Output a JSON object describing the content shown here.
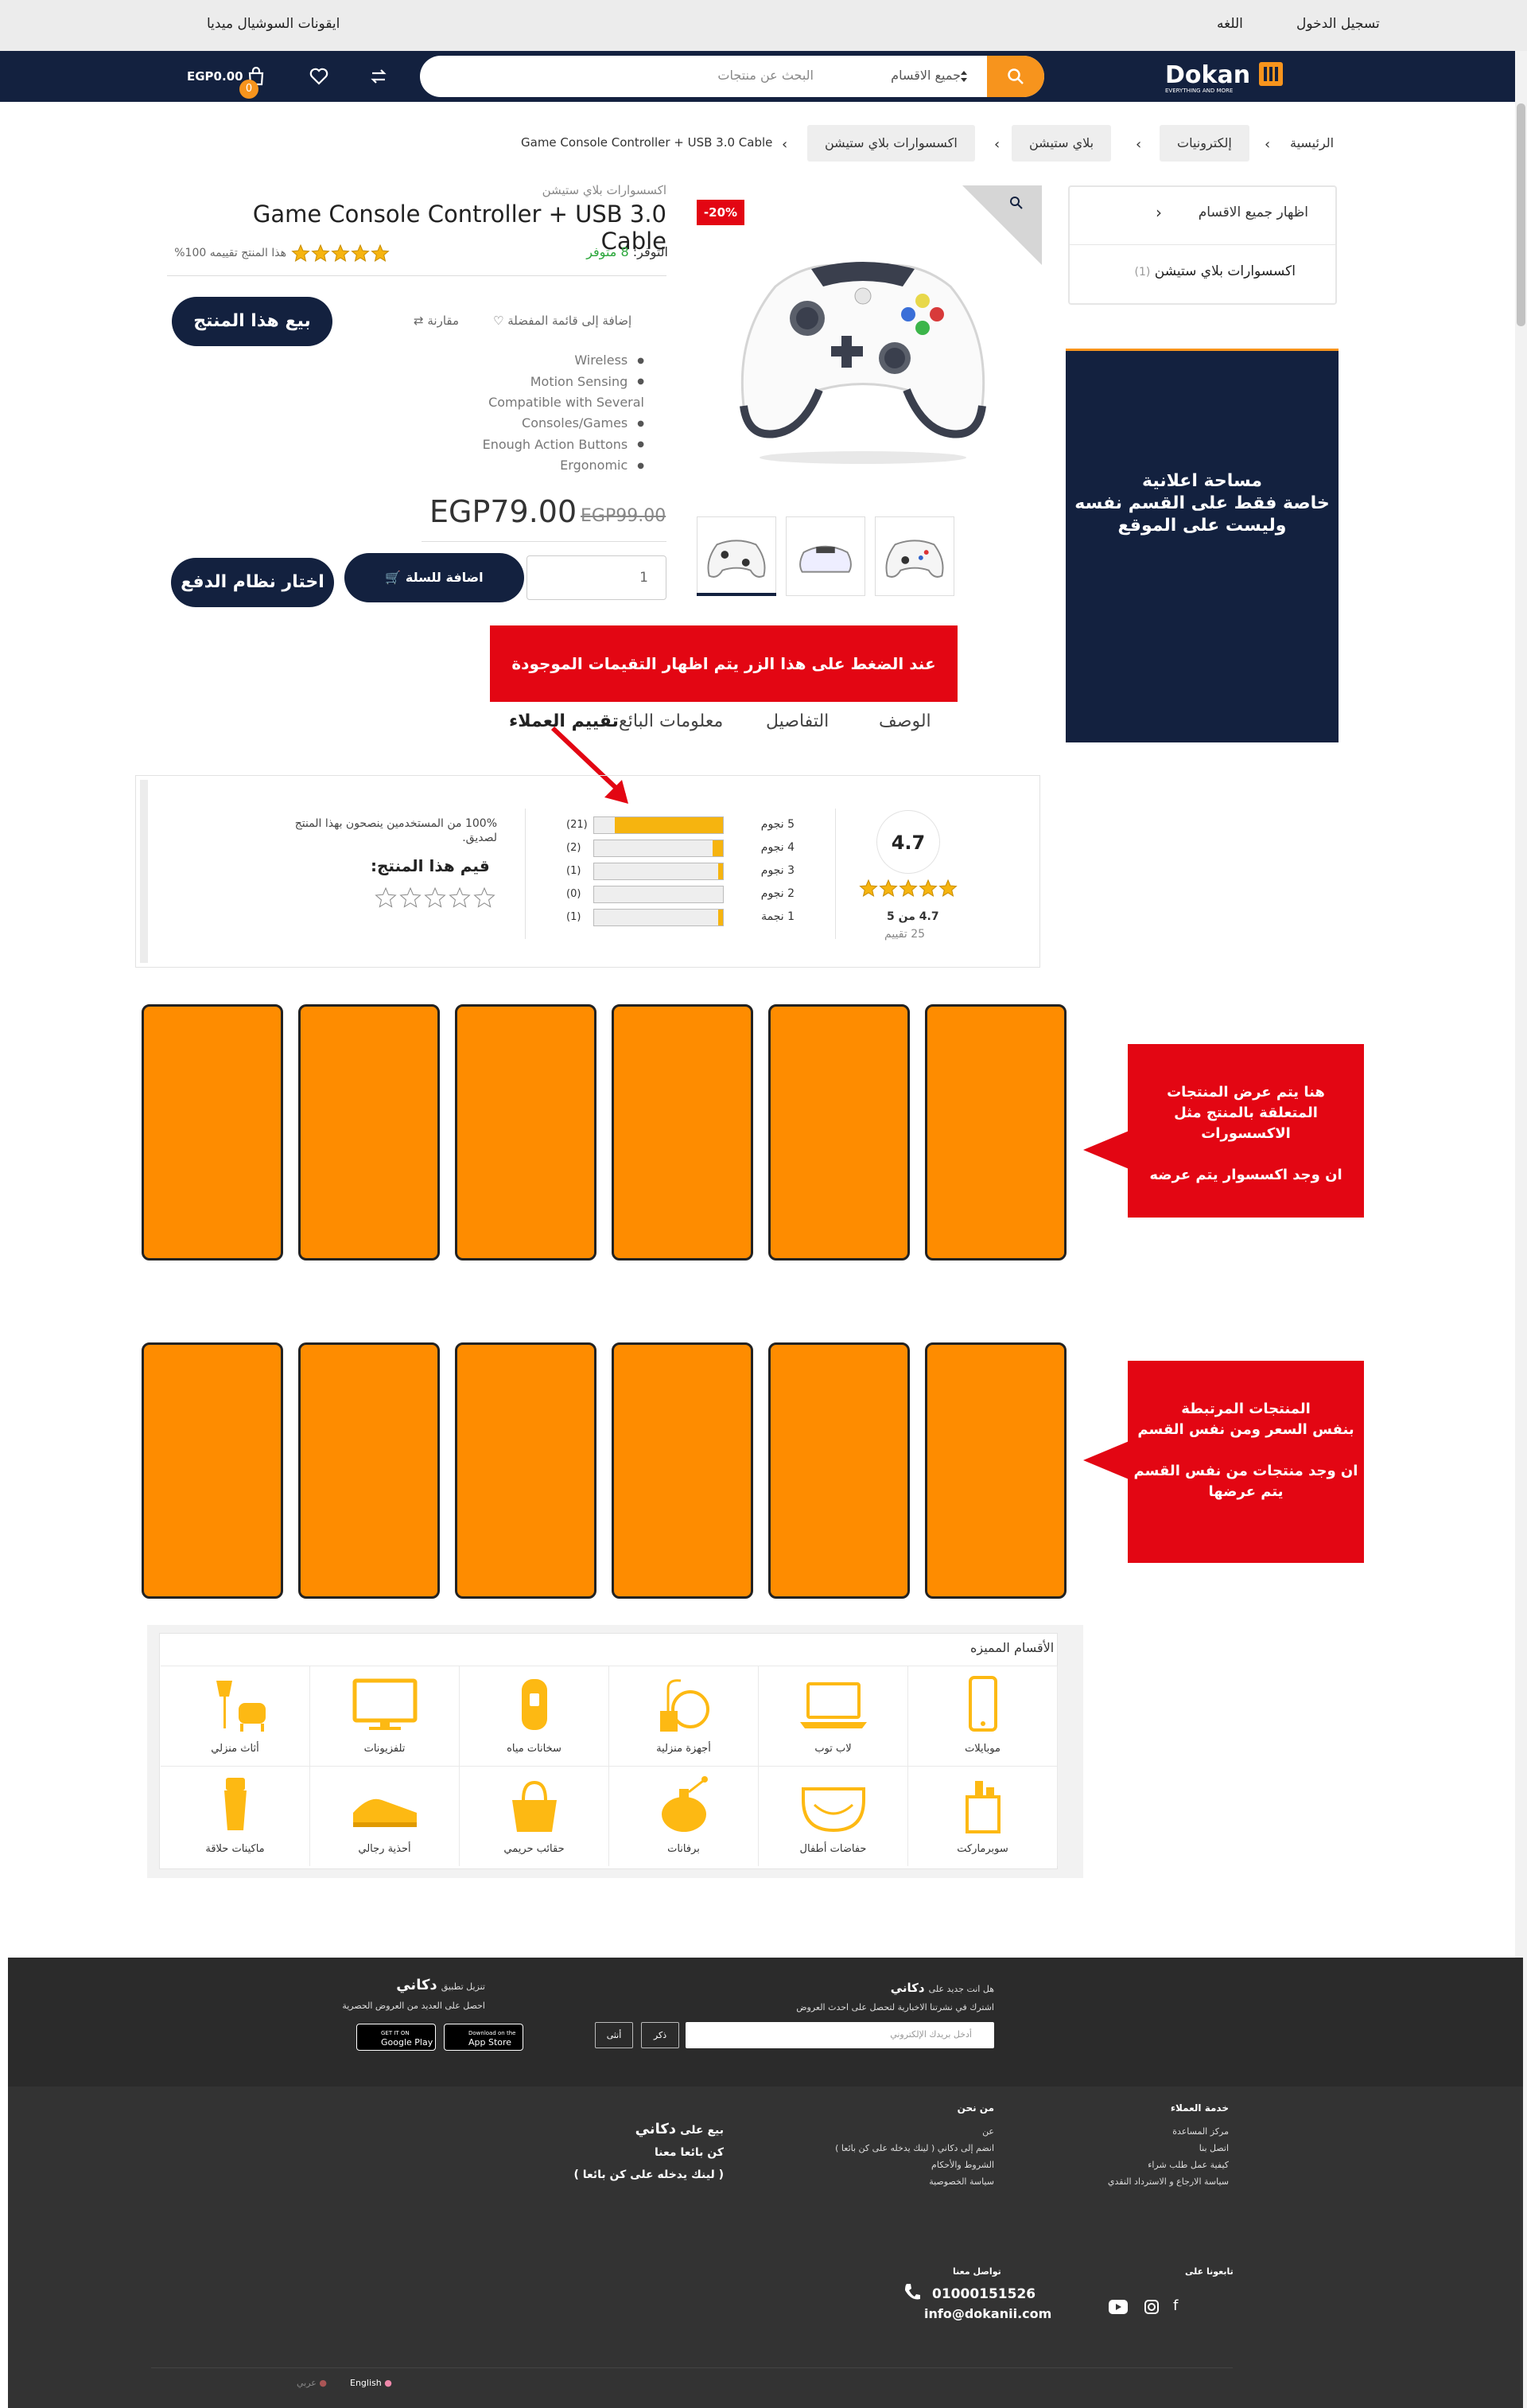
{
  "topbar": {
    "login": "تسجيل الدخول",
    "language": "اللغه",
    "social": "ايقونات السوشيال ميديا"
  },
  "header": {
    "logo": "Dokan",
    "logo_tag": "EVERYTHING AND MORE",
    "search_placeholder": "البحث عن منتجات",
    "category_select": "جميع الاقسام",
    "cart_total": "EGP0.00",
    "cart_count": "0"
  },
  "breadcrumb": [
    "الرئيسية",
    "إلكترونيات",
    "بلاي ستيشن",
    "اكسسوارات بلاي ستيشن",
    "Game Console Controller + USB 3.0 Cable"
  ],
  "sidebar": {
    "all_categories": "اظهار جميع الاقسام",
    "current": "اكسسوارات بلاي ستيشن",
    "current_count": "(1)",
    "ad_text": [
      "مساحة اعلانية",
      "خاصة فقط على القسم نفسه",
      "وليست على الموقع"
    ]
  },
  "product": {
    "discount": "-20%",
    "category": "اكسسوارات بلاي ستيشن",
    "title": "Game Console Controller + USB 3.0 Cable",
    "stock_label": "التوفر:",
    "stock_value": "8 متوفر",
    "rating_text": "هذا المنتج تقييمه 100%",
    "sell_button": "بيع هذا المنتج",
    "wishlist": "إضافة إلى قائمة المفضلة",
    "compare": "مقارنة",
    "features": [
      "Wireless",
      "Motion Sensing",
      "Compatible with Several Consoles/Games",
      "Enough Action Buttons",
      "Ergonomic"
    ],
    "price": "EGP79.00",
    "old_price": "EGP99.00",
    "quantity": "1",
    "add_to_cart": "اضافة للسلة",
    "choose_payment": "اختار نظام الدفع",
    "rating_fraction": 1.0
  },
  "annotation_tabs": "عند الضغط على هذا الزر يتم اظهار التقيمات الموجودة",
  "tabs": [
    "الوصف",
    "التفاصيل",
    "معلومات البائع",
    "تقييم العملاء"
  ],
  "reviews": {
    "average": "4.7",
    "of_five": "4.7 من 5",
    "count_label": "25 تقييم",
    "bars": [
      {
        "label": "5 نجوم",
        "count": "(21)",
        "fraction": 0.84
      },
      {
        "label": "4 نجوم",
        "count": "(2)",
        "fraction": 0.08
      },
      {
        "label": "3 نجوم",
        "count": "(1)",
        "fraction": 0.04
      },
      {
        "label": "2 نجوم",
        "count": "(0)",
        "fraction": 0.0
      },
      {
        "label": "1 نجمة",
        "count": "(1)",
        "fraction": 0.04
      }
    ],
    "percent_text": "100% من المستخدمين ينصحون بهذا المنتج لصديق.",
    "rate_label": "قيم هذا المنتج:"
  },
  "callouts": {
    "related": [
      "هنا يتم عرض المنتجات",
      "المتعلقة بالمنتج مثل الاكسسورات",
      "",
      "ان وجد اكسسوار يتم عرضه"
    ],
    "linked": [
      "المنتجات المرتبطة",
      "بنفس السعر ومن نفس القسم",
      "",
      "ان وجد منتجات من نفس القسم",
      "يتم عرضها"
    ]
  },
  "categories": {
    "title": "الأقسام المميزه",
    "items": [
      "موبايلات",
      "لاب توب",
      "أجهزة منزلية",
      "سخانات مياه",
      "تلفزيونات",
      "أثاث منزلي",
      "سوبرماركت",
      "حفاضات أطفال",
      "برفانات",
      "حقائب حريمي",
      "أحذية رجالي",
      "ماكينات حلاقة"
    ]
  },
  "footer": {
    "new_q": "هل انت جديد على",
    "brand": "دكاني",
    "subscribe_text": "اشترك في نشرتنا الاخبارية لتحصل على احدث العروض",
    "email_placeholder": "أدخل بريدك الإلكتروني",
    "male": "ذكر",
    "female": "أنثى",
    "app_title": "تنزيل تطبيق",
    "app_sub": "احصل على العديد من العروض الحصرية",
    "google_small": "GET IT ON",
    "google": "Google Play",
    "apple_small": "Download on the",
    "apple": "App Store",
    "cs_title": "خدمة العملاء",
    "cs_items": [
      "مركز المساعدة",
      "اتصل بنا",
      "كيفية عمل طلب شراء",
      "سياسة الارجاع و الاسترداد النقدي"
    ],
    "about_title": "من نحن",
    "about_items": [
      "عن",
      "انضم إلى  دكاني  ( لينك يدخله على كن بائعا )",
      "الشروط والأحكام",
      "سياسة الخصوصية"
    ],
    "sell_title": "بيع على",
    "sell_brand": "دكاني",
    "be_seller": "كن بائعا معنا",
    "seller_link": "( لينك يدخله على كن بائعا )",
    "follow": "تابعونا على",
    "contact": "تواصل معنا",
    "phone": "01000151526",
    "email": "info@dokanii.com",
    "lang_en": "English",
    "lang_ar": "عربي"
  }
}
